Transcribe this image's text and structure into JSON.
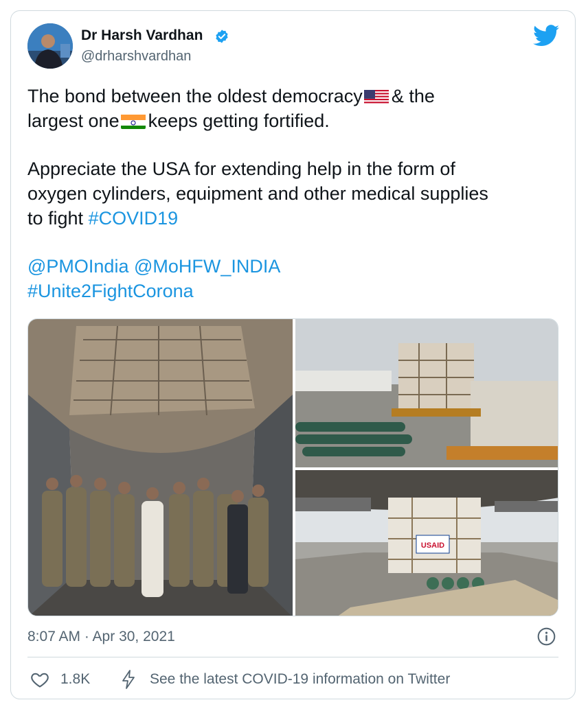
{
  "author": {
    "name": "Dr Harsh Vardhan",
    "handle": "@drharshvardhan"
  },
  "tweet": {
    "line1_a": "The bond between the oldest democracy",
    "line1_b": "& the",
    "line2_a": "largest one",
    "line2_b": "keeps getting fortified.",
    "line3": "Appreciate the USA for extending help in the form of",
    "line4": "oxygen cylinders, equipment and other medical supplies",
    "line5_a": "to fight ",
    "hashtag_covid": "#COVID19",
    "mention_pmo": "@PMOIndia",
    "mention_mohfw": "@MoHFW_INDIA",
    "hashtag_unite": "#Unite2FightCorona"
  },
  "media": {
    "crate_label": "USAID"
  },
  "meta": {
    "timestamp": "8:07 AM · Apr 30, 2021",
    "likes": "1.8K",
    "covid_info": "See the latest COVID-19 information on Twitter"
  },
  "icons": [
    "verified-badge-icon",
    "twitter-bird-icon",
    "info-icon",
    "heart-icon",
    "lightning-bolt-icon"
  ],
  "colors": {
    "link": "#1b95e0",
    "text": "#0f1419",
    "secondary": "#536471",
    "border": "#cfd9de",
    "twitter_blue": "#1da1f2"
  }
}
